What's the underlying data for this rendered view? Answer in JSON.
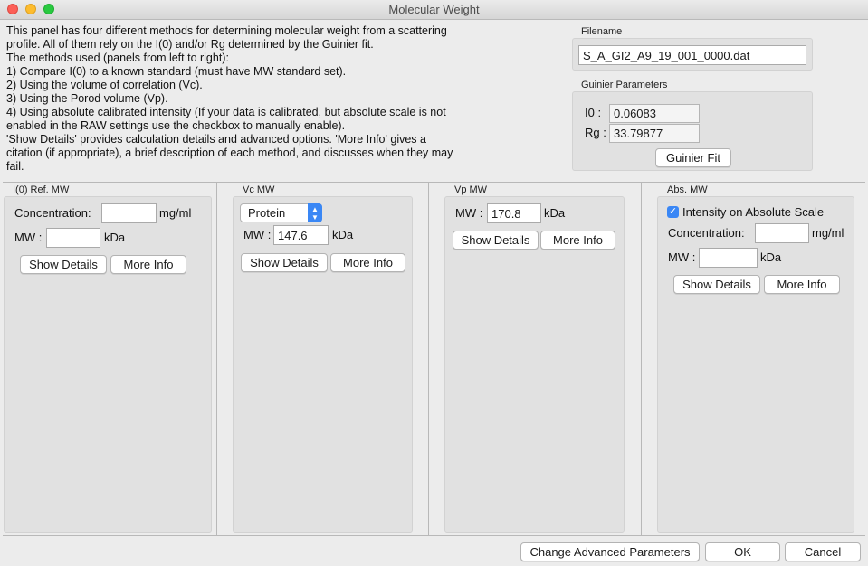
{
  "window": {
    "title": "Molecular Weight"
  },
  "description": [
    "This panel has four different methods for determining molecular weight from a scattering",
    "profile. All of them rely on the I(0) and/or Rg determined by the Guinier fit.",
    "The methods used (panels from left to right):",
    "1) Compare I(0) to a known standard (must have MW standard set).",
    "2) Using the volume of correlation (Vc).",
    "3) Using the Porod volume (Vp).",
    "4) Using absolute calibrated intensity (If your data is calibrated, but absolute scale is not",
    "enabled in the RAW settings use the checkbox to manually enable).",
    "'Show Details' provides calculation details and advanced options. 'More Info' gives a",
    "citation (if appropriate), a brief description of each method, and discusses when they may",
    "fail."
  ],
  "filename": {
    "label": "Filename",
    "value": "S_A_GI2_A9_19_001_0000.dat"
  },
  "guinier": {
    "label": "Guinier Parameters",
    "i0_label": "I0 :",
    "i0_value": "0.06083",
    "rg_label": "Rg :",
    "rg_value": "33.79877",
    "fit_button": "Guinier Fit"
  },
  "panels": {
    "i0": {
      "title": "I(0) Ref. MW",
      "conc_label": "Concentration:",
      "conc_value": "",
      "conc_unit": "mg/ml",
      "mw_label": "MW :",
      "mw_value": "",
      "mw_unit": "kDa",
      "details_button": "Show Details",
      "info_button": "More Info"
    },
    "vc": {
      "title": "Vc MW",
      "type_selected": "Protein",
      "mw_label": "MW :",
      "mw_value": "147.6",
      "mw_unit": "kDa",
      "details_button": "Show Details",
      "info_button": "More Info"
    },
    "vp": {
      "title": "Vp MW",
      "mw_label": "MW :",
      "mw_value": "170.8",
      "mw_unit": "kDa",
      "details_button": "Show Details",
      "info_button": "More Info"
    },
    "abs": {
      "title": "Abs. MW",
      "checkbox_label": "Intensity on Absolute Scale",
      "checkbox_checked": true,
      "conc_label": "Concentration:",
      "conc_value": "",
      "conc_unit": "mg/ml",
      "mw_label": "MW :",
      "mw_value": "",
      "mw_unit": "kDa",
      "details_button": "Show Details",
      "info_button": "More Info"
    }
  },
  "footer": {
    "advanced_button": "Change Advanced Parameters",
    "ok_button": "OK",
    "cancel_button": "Cancel"
  },
  "colors": {
    "accent": "#3a87f5",
    "close": "#fc5f57",
    "minimize": "#fdbc2e",
    "maximize": "#29c940"
  },
  "icons": {
    "select_arrows": "chevron-up-down-icon",
    "checkbox_mark": "checkmark-icon"
  }
}
